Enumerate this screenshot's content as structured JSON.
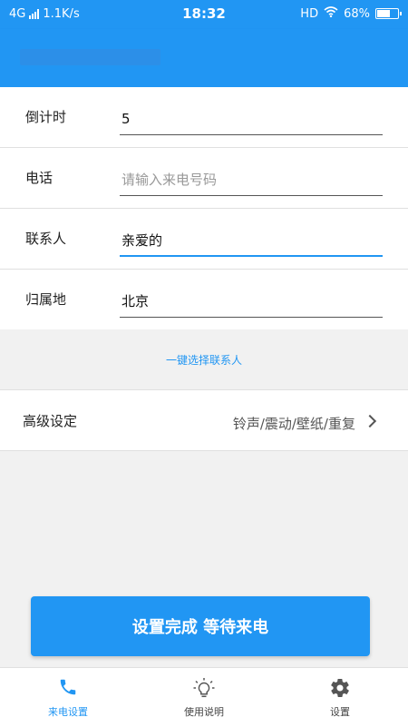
{
  "status_bar": {
    "network": "4G",
    "speed": "1.1K/s",
    "time": "18:32",
    "hd": "HD",
    "battery": "68%",
    "battery_level": 0.68
  },
  "app_bar": {
    "title": ""
  },
  "form": {
    "countdown": {
      "label": "倒计时",
      "value": "5"
    },
    "phone": {
      "label": "电话",
      "value": "",
      "placeholder": "请输入来电号码"
    },
    "contact": {
      "label": "联系人",
      "value": "亲爱的"
    },
    "location": {
      "label": "归属地",
      "value": "北京"
    }
  },
  "pick_contact_link": "一键选择联系人",
  "advanced": {
    "label": "高级设定",
    "value": "铃声/震动/壁纸/重复"
  },
  "done_button": "设置完成 等待来电",
  "tabs": [
    {
      "label": "来电设置",
      "icon": "phone-icon",
      "active": true
    },
    {
      "label": "使用说明",
      "icon": "lightbulb-icon",
      "active": false
    },
    {
      "label": "设置",
      "icon": "gear-icon",
      "active": false
    }
  ],
  "colors": {
    "primary": "#2196f3",
    "background": "#f1f1f1"
  }
}
